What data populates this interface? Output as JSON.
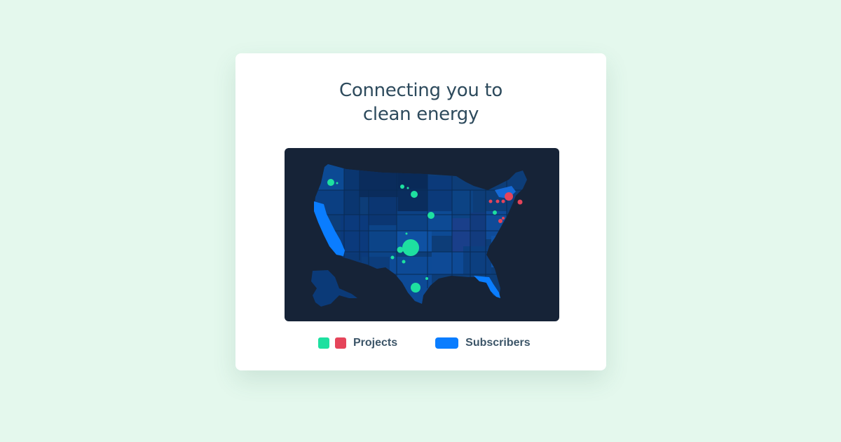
{
  "card": {
    "title_line1": "Connecting you to",
    "title_line2": "clean energy"
  },
  "legend": {
    "projects_label": "Projects",
    "subscribers_label": "Subscribers"
  },
  "colors": {
    "page_background": "#e4f8ed",
    "map_background": "#162337",
    "project_green": "#1ee0a0",
    "project_red": "#e5445a",
    "subscriber_blue": "#0a7dff",
    "title_text": "#2d4a5c",
    "legend_text": "#3c5568"
  },
  "map": {
    "region": "United States",
    "subscriber_states": [
      "California",
      "Florida"
    ],
    "project_marker_colors": [
      "green",
      "red"
    ]
  }
}
